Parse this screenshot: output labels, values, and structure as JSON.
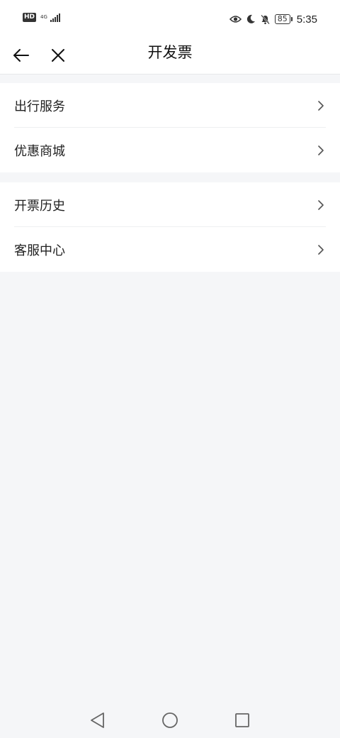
{
  "status_bar": {
    "hd_label": "HD",
    "network_top": "4G",
    "network_bottom": "⁴⁶",
    "battery_level": "85",
    "time": "5:35"
  },
  "header": {
    "title": "开发票",
    "back_icon": "arrow-left-icon",
    "close_icon": "close-icon"
  },
  "menu_groups": [
    {
      "items": [
        {
          "label": "出行服务"
        },
        {
          "label": "优惠商城"
        }
      ]
    },
    {
      "items": [
        {
          "label": "开票历史"
        },
        {
          "label": "客服中心"
        }
      ]
    }
  ],
  "system_nav": {
    "back_icon": "triangle-back-icon",
    "home_icon": "circle-home-icon",
    "recent_icon": "square-recent-icon"
  },
  "colors": {
    "page_background": "#f5f6f8",
    "card_background": "#ffffff",
    "text_primary": "#222222",
    "divider": "#eeeff1",
    "chevron": "#555555"
  }
}
